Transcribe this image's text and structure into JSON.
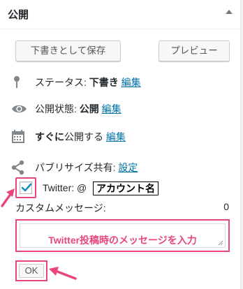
{
  "panel": {
    "title": "公開",
    "toggle_icon": "triangle-up-icon"
  },
  "actions": {
    "save_draft": "下書きとして保存",
    "preview": "プレビュー"
  },
  "status": {
    "icon": "pin-icon",
    "label": "ステータス:",
    "value": "下書き",
    "edit": "編集"
  },
  "visibility": {
    "icon": "eye-icon",
    "label": "公開状態:",
    "value": "公開",
    "edit": "編集"
  },
  "schedule": {
    "icon": "calendar-icon",
    "value": "すぐに",
    "label": "公開する",
    "edit": "編集"
  },
  "publicize": {
    "icon": "share-icon",
    "label": "パブリサイズ共有:",
    "settings": "設定"
  },
  "twitter": {
    "checked": true,
    "label": "Twitter: @",
    "account": "アカウント名"
  },
  "custom_message": {
    "label": "カスタムメッセージ:",
    "count": "0",
    "placeholder": "Twitter投稿時のメッセージを入力"
  },
  "ok_button": "OK",
  "colors": {
    "link": "#0073aa",
    "highlight": "#e8467c",
    "text": "#23282d"
  }
}
